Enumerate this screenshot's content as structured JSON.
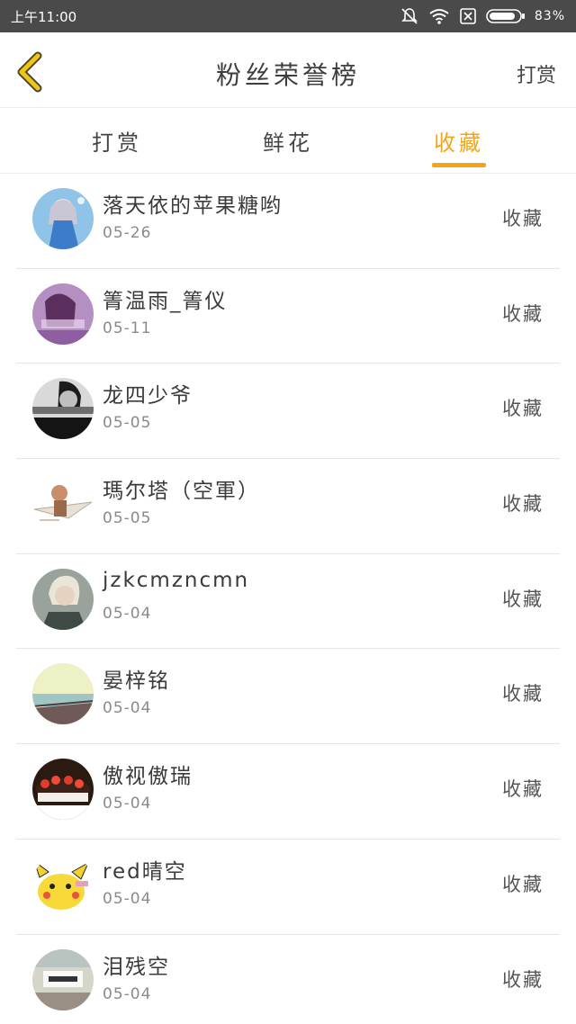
{
  "status_bar": {
    "time": "上午11:00",
    "battery": "83%",
    "icons": [
      "mute-icon",
      "wifi-icon",
      "sim-off-icon",
      "battery-icon"
    ]
  },
  "header": {
    "back_icon": "chevron-left-icon",
    "title": "粉丝荣誉榜",
    "action": "打赏"
  },
  "tabs": [
    {
      "label": "打赏",
      "active": false
    },
    {
      "label": "鲜花",
      "active": false
    },
    {
      "label": "收藏",
      "active": true
    }
  ],
  "colors": {
    "accent": "#f2a516",
    "status_bar": "#4a4a4a"
  },
  "list": [
    {
      "name": "落天依的苹果糖哟",
      "date": "05-26",
      "action": "收藏"
    },
    {
      "name": "箐温雨_箐仪",
      "date": "05-11",
      "action": "收藏"
    },
    {
      "name": "龙四少爷",
      "date": "05-05",
      "action": "收藏"
    },
    {
      "name": "瑪尔塔（空軍）",
      "date": "05-05",
      "action": "收藏"
    },
    {
      "name": "jzkcmzncmn",
      "date": "05-04",
      "action": "收藏"
    },
    {
      "name": "晏梓铭",
      "date": "05-04",
      "action": "收藏"
    },
    {
      "name": "傲视傲瑞",
      "date": "05-04",
      "action": "收藏"
    },
    {
      "name": "red晴空",
      "date": "05-04",
      "action": "收藏"
    },
    {
      "name": "泪残空",
      "date": "05-04",
      "action": "收藏"
    }
  ]
}
